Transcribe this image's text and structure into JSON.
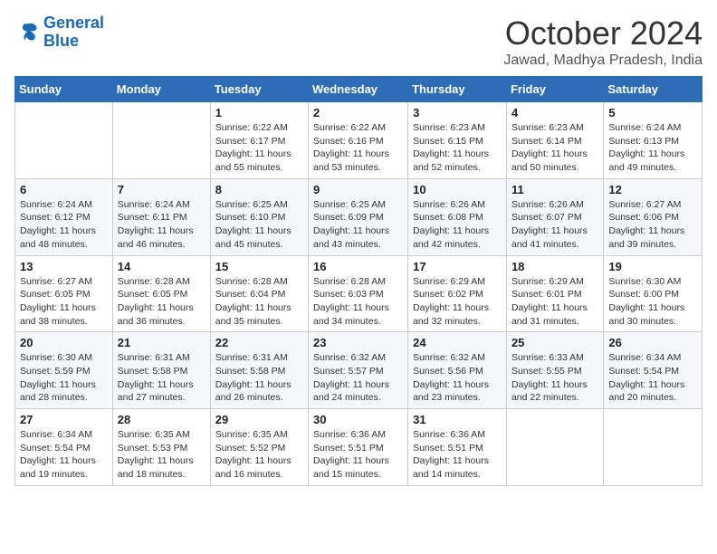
{
  "logo": {
    "line1": "General",
    "line2": "Blue"
  },
  "title": "October 2024",
  "location": "Jawad, Madhya Pradesh, India",
  "header": {
    "days": [
      "Sunday",
      "Monday",
      "Tuesday",
      "Wednesday",
      "Thursday",
      "Friday",
      "Saturday"
    ]
  },
  "weeks": [
    [
      {
        "day": "",
        "info": ""
      },
      {
        "day": "",
        "info": ""
      },
      {
        "day": "1",
        "sunrise": "6:22 AM",
        "sunset": "6:17 PM",
        "daylight": "11 hours and 55 minutes."
      },
      {
        "day": "2",
        "sunrise": "6:22 AM",
        "sunset": "6:16 PM",
        "daylight": "11 hours and 53 minutes."
      },
      {
        "day": "3",
        "sunrise": "6:23 AM",
        "sunset": "6:15 PM",
        "daylight": "11 hours and 52 minutes."
      },
      {
        "day": "4",
        "sunrise": "6:23 AM",
        "sunset": "6:14 PM",
        "daylight": "11 hours and 50 minutes."
      },
      {
        "day": "5",
        "sunrise": "6:24 AM",
        "sunset": "6:13 PM",
        "daylight": "11 hours and 49 minutes."
      }
    ],
    [
      {
        "day": "6",
        "sunrise": "6:24 AM",
        "sunset": "6:12 PM",
        "daylight": "11 hours and 48 minutes."
      },
      {
        "day": "7",
        "sunrise": "6:24 AM",
        "sunset": "6:11 PM",
        "daylight": "11 hours and 46 minutes."
      },
      {
        "day": "8",
        "sunrise": "6:25 AM",
        "sunset": "6:10 PM",
        "daylight": "11 hours and 45 minutes."
      },
      {
        "day": "9",
        "sunrise": "6:25 AM",
        "sunset": "6:09 PM",
        "daylight": "11 hours and 43 minutes."
      },
      {
        "day": "10",
        "sunrise": "6:26 AM",
        "sunset": "6:08 PM",
        "daylight": "11 hours and 42 minutes."
      },
      {
        "day": "11",
        "sunrise": "6:26 AM",
        "sunset": "6:07 PM",
        "daylight": "11 hours and 41 minutes."
      },
      {
        "day": "12",
        "sunrise": "6:27 AM",
        "sunset": "6:06 PM",
        "daylight": "11 hours and 39 minutes."
      }
    ],
    [
      {
        "day": "13",
        "sunrise": "6:27 AM",
        "sunset": "6:05 PM",
        "daylight": "11 hours and 38 minutes."
      },
      {
        "day": "14",
        "sunrise": "6:28 AM",
        "sunset": "6:05 PM",
        "daylight": "11 hours and 36 minutes."
      },
      {
        "day": "15",
        "sunrise": "6:28 AM",
        "sunset": "6:04 PM",
        "daylight": "11 hours and 35 minutes."
      },
      {
        "day": "16",
        "sunrise": "6:28 AM",
        "sunset": "6:03 PM",
        "daylight": "11 hours and 34 minutes."
      },
      {
        "day": "17",
        "sunrise": "6:29 AM",
        "sunset": "6:02 PM",
        "daylight": "11 hours and 32 minutes."
      },
      {
        "day": "18",
        "sunrise": "6:29 AM",
        "sunset": "6:01 PM",
        "daylight": "11 hours and 31 minutes."
      },
      {
        "day": "19",
        "sunrise": "6:30 AM",
        "sunset": "6:00 PM",
        "daylight": "11 hours and 30 minutes."
      }
    ],
    [
      {
        "day": "20",
        "sunrise": "6:30 AM",
        "sunset": "5:59 PM",
        "daylight": "11 hours and 28 minutes."
      },
      {
        "day": "21",
        "sunrise": "6:31 AM",
        "sunset": "5:58 PM",
        "daylight": "11 hours and 27 minutes."
      },
      {
        "day": "22",
        "sunrise": "6:31 AM",
        "sunset": "5:58 PM",
        "daylight": "11 hours and 26 minutes."
      },
      {
        "day": "23",
        "sunrise": "6:32 AM",
        "sunset": "5:57 PM",
        "daylight": "11 hours and 24 minutes."
      },
      {
        "day": "24",
        "sunrise": "6:32 AM",
        "sunset": "5:56 PM",
        "daylight": "11 hours and 23 minutes."
      },
      {
        "day": "25",
        "sunrise": "6:33 AM",
        "sunset": "5:55 PM",
        "daylight": "11 hours and 22 minutes."
      },
      {
        "day": "26",
        "sunrise": "6:34 AM",
        "sunset": "5:54 PM",
        "daylight": "11 hours and 20 minutes."
      }
    ],
    [
      {
        "day": "27",
        "sunrise": "6:34 AM",
        "sunset": "5:54 PM",
        "daylight": "11 hours and 19 minutes."
      },
      {
        "day": "28",
        "sunrise": "6:35 AM",
        "sunset": "5:53 PM",
        "daylight": "11 hours and 18 minutes."
      },
      {
        "day": "29",
        "sunrise": "6:35 AM",
        "sunset": "5:52 PM",
        "daylight": "11 hours and 16 minutes."
      },
      {
        "day": "30",
        "sunrise": "6:36 AM",
        "sunset": "5:51 PM",
        "daylight": "11 hours and 15 minutes."
      },
      {
        "day": "31",
        "sunrise": "6:36 AM",
        "sunset": "5:51 PM",
        "daylight": "11 hours and 14 minutes."
      },
      {
        "day": "",
        "info": ""
      },
      {
        "day": "",
        "info": ""
      }
    ]
  ]
}
